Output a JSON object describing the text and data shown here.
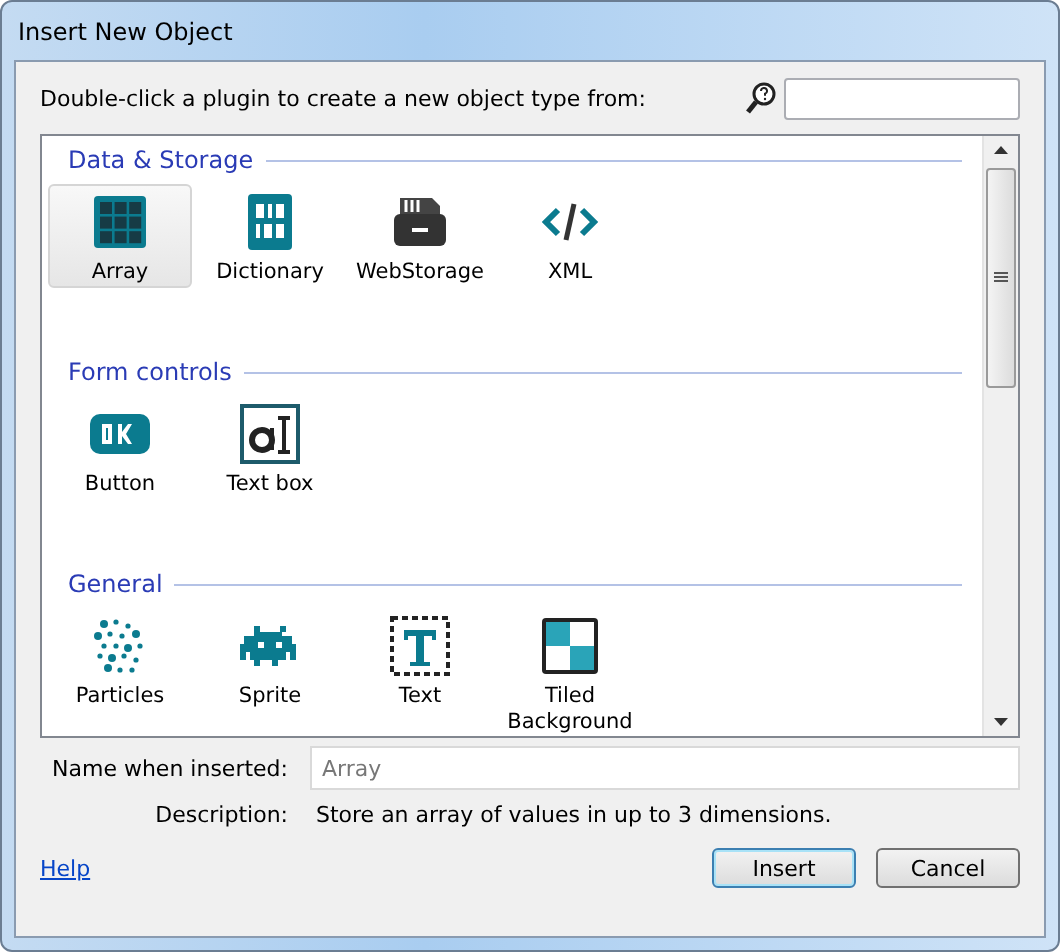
{
  "window": {
    "title": "Insert New Object"
  },
  "instruction": "Double-click a plugin to create a new object type from:",
  "groups": [
    {
      "title": "Data & Storage",
      "items": [
        {
          "label": "Array",
          "kind": "array",
          "selected": true
        },
        {
          "label": "Dictionary",
          "kind": "dictionary",
          "selected": false
        },
        {
          "label": "WebStorage",
          "kind": "webstorage",
          "selected": false
        },
        {
          "label": "XML",
          "kind": "xml",
          "selected": false
        }
      ]
    },
    {
      "title": "Form controls",
      "items": [
        {
          "label": "Button",
          "kind": "button",
          "selected": false
        },
        {
          "label": "Text box",
          "kind": "textbox",
          "selected": false
        }
      ]
    },
    {
      "title": "General",
      "items": [
        {
          "label": "Particles",
          "kind": "particles",
          "selected": false
        },
        {
          "label": "Sprite",
          "kind": "sprite",
          "selected": false
        },
        {
          "label": "Text",
          "kind": "text",
          "selected": false
        },
        {
          "label": "Tiled Background",
          "kind": "tiled",
          "selected": false
        }
      ]
    }
  ],
  "name_field": {
    "label": "Name when inserted:",
    "placeholder": "Array"
  },
  "description": {
    "label": "Description:",
    "text": "Store an array of values in up to 3 dimensions."
  },
  "help_link": "Help",
  "buttons": [
    {
      "label": "Insert",
      "kind": "default"
    },
    {
      "label": "Cancel",
      "kind": "normal"
    }
  ]
}
